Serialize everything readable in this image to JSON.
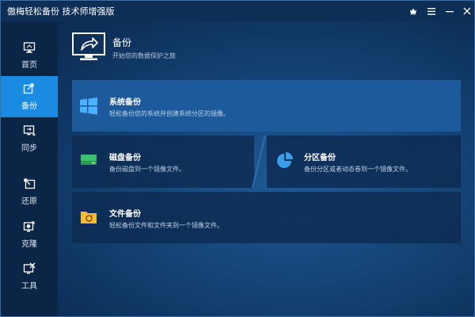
{
  "window": {
    "title": "傲梅轻松备份 技术师增强版",
    "controls": [
      "crown-icon",
      "menu-icon",
      "minimize-icon",
      "close-icon"
    ]
  },
  "sidebar": {
    "items": [
      {
        "label": "首页",
        "icon": "home-icon",
        "active": false
      },
      {
        "label": "备份",
        "icon": "backup-icon",
        "active": true
      },
      {
        "label": "同步",
        "icon": "sync-icon",
        "active": false
      },
      {
        "label": "还原",
        "icon": "restore-icon",
        "active": false
      },
      {
        "label": "克隆",
        "icon": "clone-icon",
        "active": false
      },
      {
        "label": "工具",
        "icon": "tools-icon",
        "active": false
      }
    ]
  },
  "header": {
    "title": "备份",
    "subtitle": "开始您的数据保护之旅"
  },
  "cards": {
    "system_backup": {
      "title": "系统备份",
      "desc": "轻松备份您的系统并创建系统分区的镜像。"
    },
    "disk_backup": {
      "title": "磁盘备份",
      "desc": "备份磁盘到一个镜像文件。"
    },
    "partition_backup": {
      "title": "分区备份",
      "desc": "备份分区或者动态卷到一个镜像文件。"
    },
    "file_backup": {
      "title": "文件备份",
      "desc": "轻松备份文件和文件夹到一个镜像文件。"
    }
  },
  "colors": {
    "accent": "#1a8be0",
    "sidebar_bg": "#0a2545",
    "selected_card": "#1d5a9c",
    "disk_green": "#3cc26a",
    "partition_blue": "#3b9ee8",
    "folder_yellow": "#f3bd3a"
  }
}
